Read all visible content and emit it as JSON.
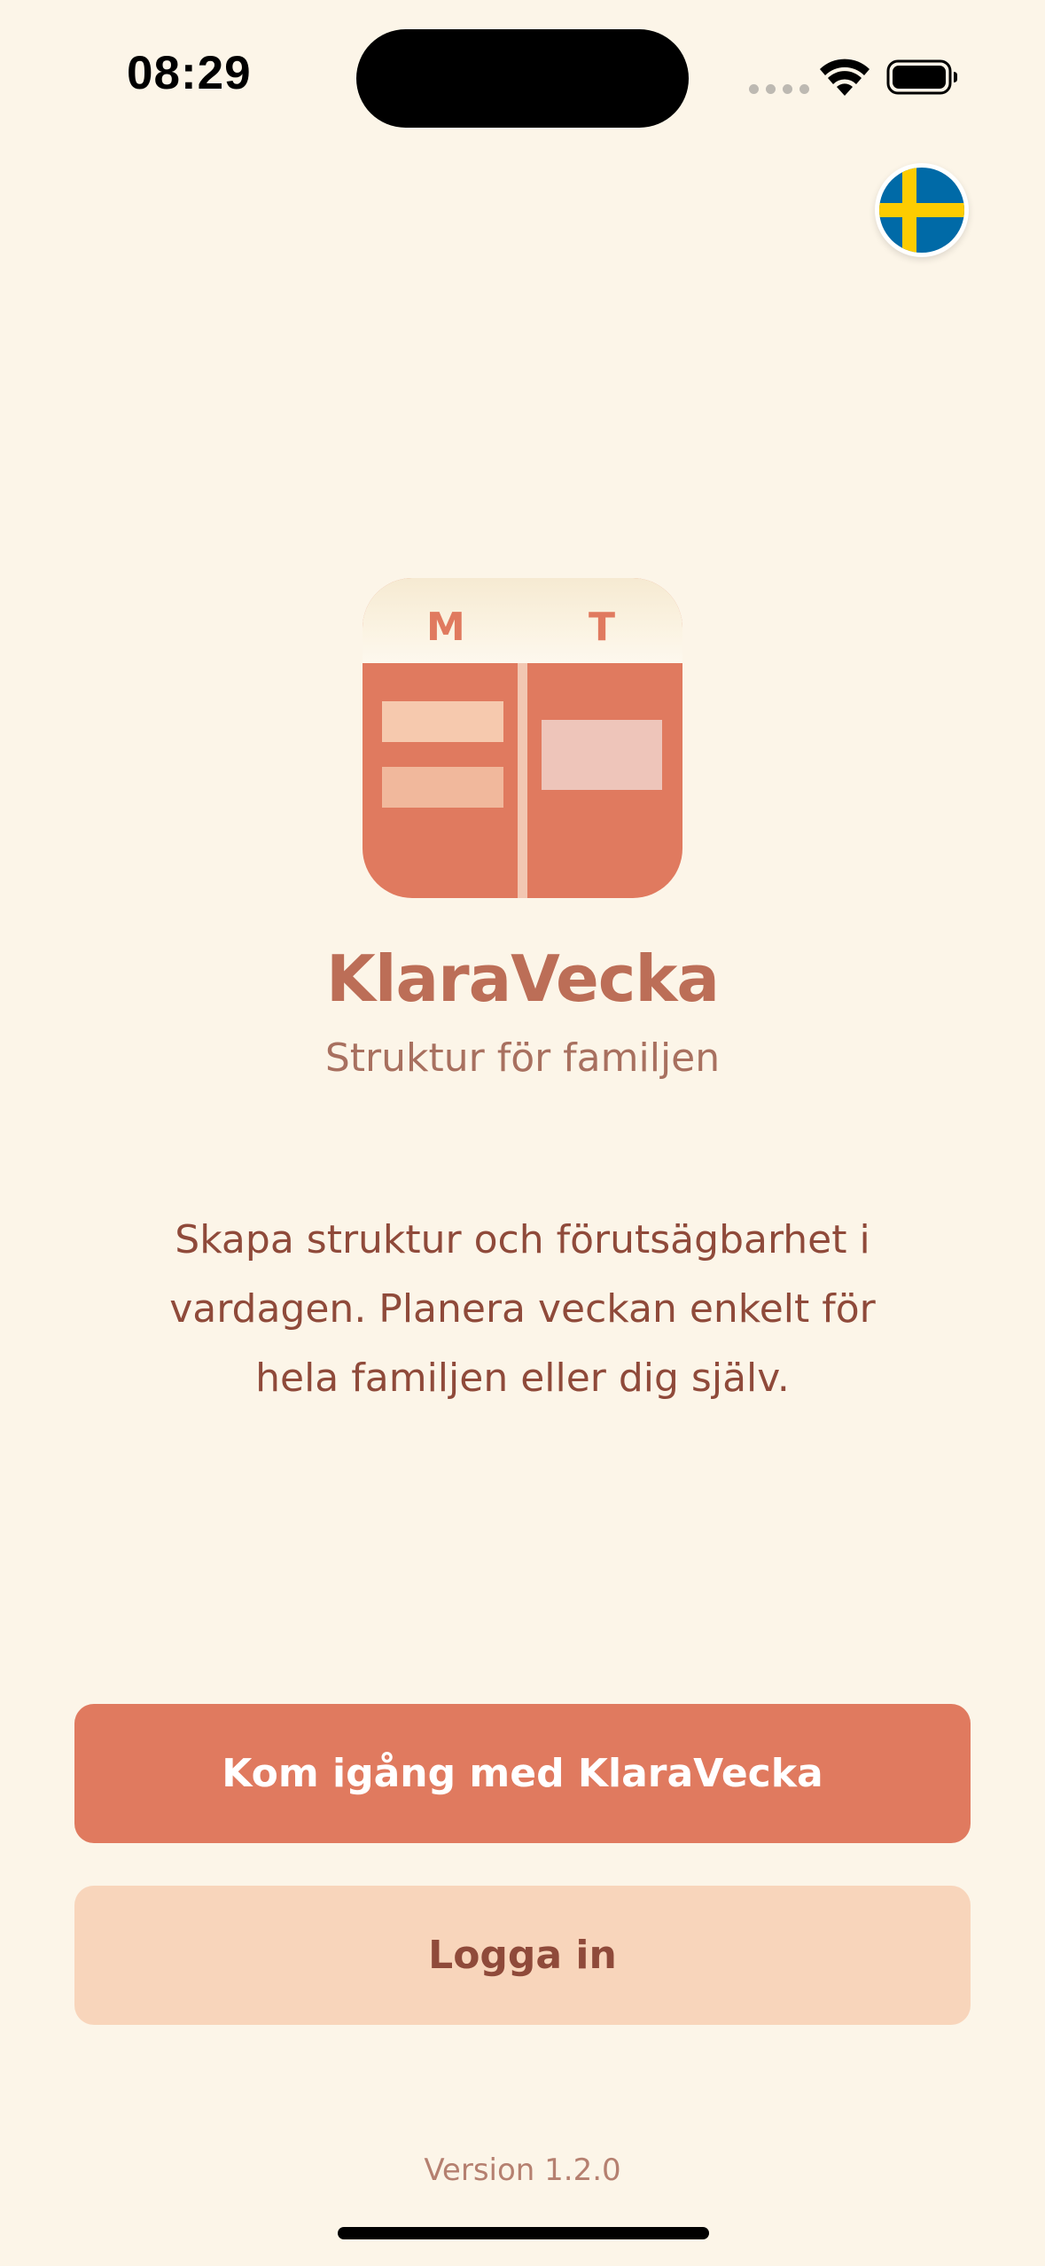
{
  "status_bar": {
    "time": "08:29"
  },
  "language": {
    "flag_icon": "sweden-flag-icon",
    "flag_colors": {
      "blue": "#006aa7",
      "yellow": "#fecc00"
    }
  },
  "logo": {
    "letter_left": "M",
    "letter_right": "T"
  },
  "app": {
    "title": "KlaraVecka",
    "subtitle": "Struktur för familjen",
    "description": "Skapa struktur och förutsägbarhet i vardagen. Planera veckan enkelt för hela familjen eller dig själv."
  },
  "actions": {
    "get_started_label": "Kom igång med KlaraVecka",
    "login_label": "Logga in"
  },
  "footer": {
    "version": "Version 1.2.0"
  },
  "colors": {
    "background": "#fcf5e8",
    "accent": "#e07a5f",
    "secondary_button": "#f8d5bb",
    "title": "#bc6e57",
    "text": "#8f4a3a"
  }
}
